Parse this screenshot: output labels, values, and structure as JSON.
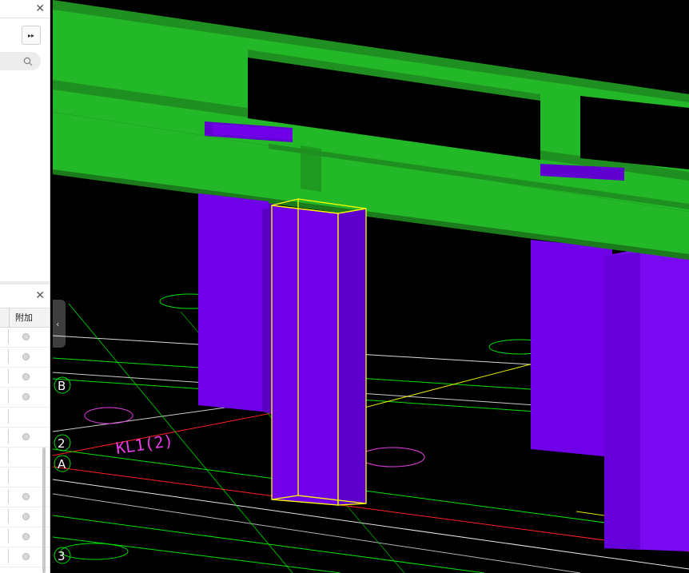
{
  "left_panel": {
    "close_symbol": "✕",
    "expand_symbol": "▸▸",
    "search_icon": "search-icon"
  },
  "property_panel": {
    "close_symbol": "✕",
    "column_header": "附加",
    "rows": [
      {
        "has_radio": true
      },
      {
        "has_radio": true
      },
      {
        "has_radio": true
      },
      {
        "has_radio": true
      },
      {
        "has_radio": false
      },
      {
        "has_radio": true
      },
      {
        "has_radio": false
      },
      {
        "has_radio": false
      },
      {
        "has_radio": true
      },
      {
        "has_radio": true
      },
      {
        "has_radio": true
      },
      {
        "has_radio": true
      }
    ]
  },
  "collapse_tab": {
    "symbol": "‹"
  },
  "viewport": {
    "colors": {
      "background": "#000000",
      "beam": "#23b827",
      "column": "#7000e8",
      "selection": "#ffff00",
      "axis_white": "#ffffff",
      "axis_green": "#00e000",
      "red_line": "#ff2020",
      "magenta_text": "#e83ce8"
    },
    "grid_labels": [
      "B",
      "2",
      "A",
      "3"
    ],
    "magenta_text": "KL1(2)"
  }
}
